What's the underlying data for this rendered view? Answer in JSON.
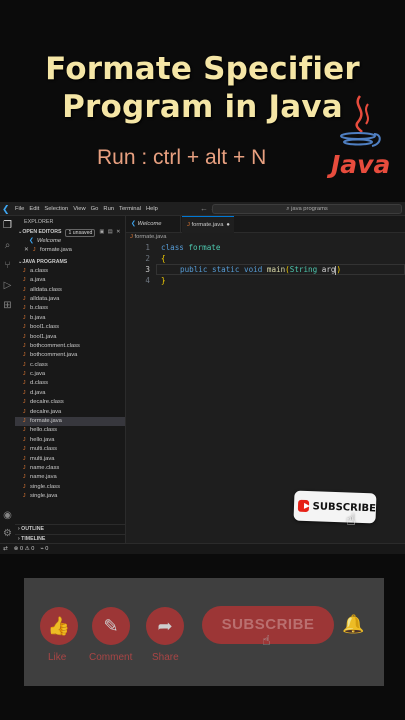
{
  "headline": {
    "line1": "Formate Specifier",
    "line2": "Program in Java",
    "shortcut": "Run : ctrl + alt + N"
  },
  "logo": {
    "word": "Java"
  },
  "vscode": {
    "menu": [
      "File",
      "Edit",
      "Selection",
      "View",
      "Go",
      "Run",
      "Terminal",
      "Help"
    ],
    "search": "java programs",
    "explorer_label": "EXPLORER",
    "open_editors": {
      "label": "OPEN EDITORS",
      "badge": "1 unsaved",
      "items": [
        {
          "name": "Welcome",
          "kind": "vscode"
        },
        {
          "name": "formate.java",
          "kind": "java"
        }
      ]
    },
    "folder": {
      "label": "JAVA PROGRAMS",
      "files": [
        "a.class",
        "a.java",
        "alldata.class",
        "alldata.java",
        "b.class",
        "b.java",
        "bool1.class",
        "bool1.java",
        "bothcomment.class",
        "bothcomment.java",
        "c.class",
        "c.java",
        "d.class",
        "d.java",
        "decalre.class",
        "decalre.java",
        "formate.java",
        "hello.class",
        "hello.java",
        "multi.class",
        "multi.java",
        "name.class",
        "name.java",
        "single.class",
        "single.java"
      ],
      "selected": "formate.java"
    },
    "outline": "OUTLINE",
    "timeline": "TIMELINE",
    "tabs": [
      {
        "label": "Welcome"
      },
      {
        "label": "formate.java",
        "modified": true
      }
    ],
    "breadcrumb": "formate.java",
    "code": {
      "lines": [
        "1",
        "2",
        "3",
        "4"
      ],
      "l1_kw": "class",
      "l1_name": "formate",
      "l2": "{",
      "l3_mod": "public static void",
      "l3_fn": "main",
      "l3_open": "(",
      "l3_type": "String",
      "l3_arg": "arg",
      "l3_close": ")",
      "l4": "}"
    },
    "status": {
      "errors": "0",
      "warnings": "0",
      "ports": "0"
    }
  },
  "subscribe_badge": "SUBSCRIBE",
  "bottom_panel": {
    "like": "Like",
    "comment": "Comment",
    "share": "Share",
    "subscribe": "SUBSCRIBE"
  },
  "colors": {
    "headline": "#f5e6a6",
    "shortcut": "#e8a080",
    "youtube_red": "#e62117",
    "java_red": "#e84c3d"
  }
}
